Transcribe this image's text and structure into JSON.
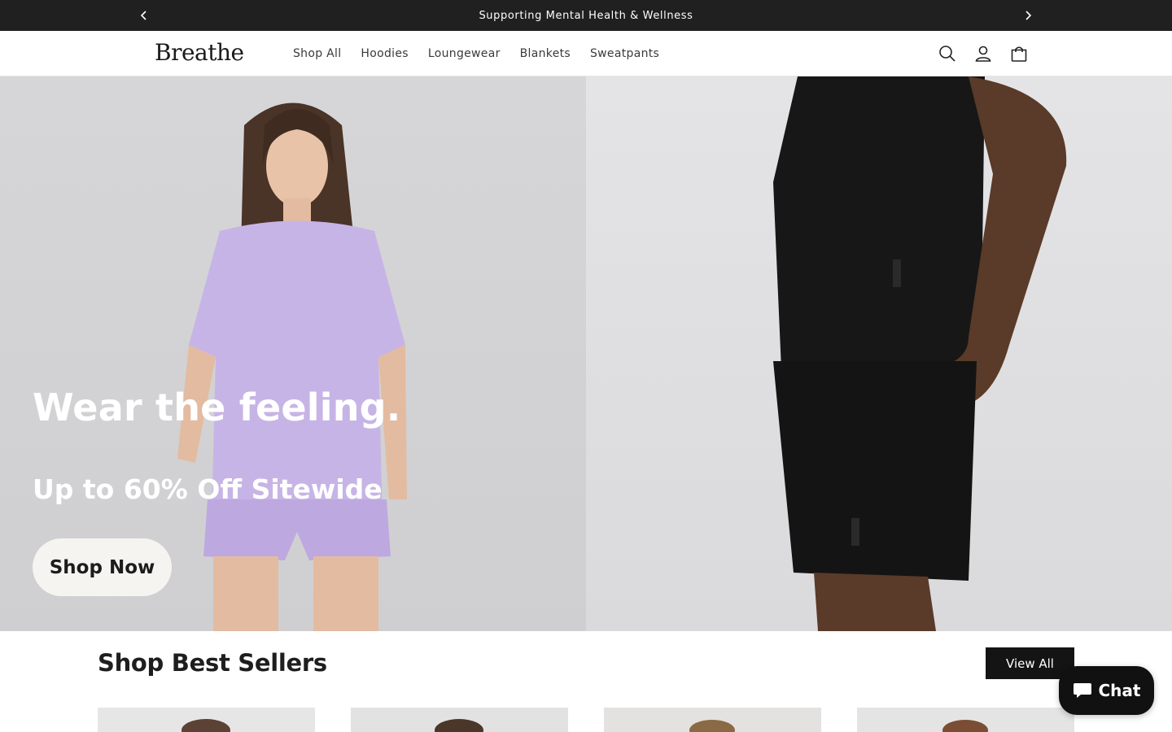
{
  "announcement": {
    "text": "Supporting Mental Health & Wellness",
    "prev_icon": "chevron-left-icon",
    "next_icon": "chevron-right-icon"
  },
  "header": {
    "logo": "Breathe",
    "nav": [
      {
        "label": "Shop All"
      },
      {
        "label": "Hoodies"
      },
      {
        "label": "Loungewear"
      },
      {
        "label": "Blankets"
      },
      {
        "label": "Sweatpants"
      }
    ],
    "icons": [
      "search-icon",
      "account-icon",
      "cart-icon"
    ]
  },
  "hero": {
    "headline": "Wear the feeling.",
    "subheadline": "Up to 60% Off Sitewide",
    "cta_label": "Shop Now"
  },
  "best_sellers": {
    "title": "Shop Best Sellers",
    "view_all_label": "View All",
    "cards": [
      {},
      {},
      {},
      {}
    ]
  },
  "chat": {
    "label": "Chat",
    "icon": "chat-bubble-icon"
  },
  "colors": {
    "announcement_bg": "#202020",
    "primary_dark": "#141414",
    "hero_shirt_lavender": "#c9b6e6",
    "hero_black_apparel": "#161616"
  }
}
